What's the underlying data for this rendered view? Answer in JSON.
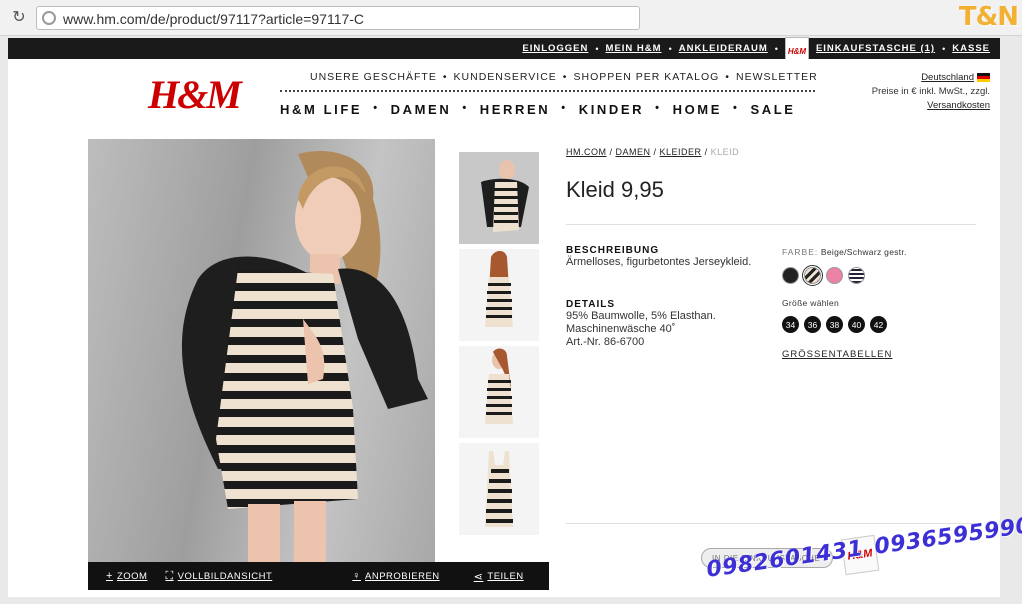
{
  "browser": {
    "url": "www.hm.com/de/product/97117?article=97117-C",
    "reload_icon": "reload-icon"
  },
  "watermark": {
    "logo": "T&N",
    "phones": [
      "0982601431",
      "0936595990"
    ]
  },
  "topbar": {
    "items": [
      "EINLOGGEN",
      "MEIN H&M",
      "ANKLEIDERAUM",
      "EINKAUFSTASCHE (1)",
      "KASSE"
    ]
  },
  "header": {
    "logo": "H&M",
    "subnav": [
      "UNSERE GESCHÄFTE",
      "KUNDENSERVICE",
      "SHOPPEN PER KATALOG",
      "NEWSLETTER"
    ],
    "mainnav": [
      "H&M LIFE",
      "DAMEN",
      "HERREN",
      "KINDER",
      "HOME",
      "SALE"
    ],
    "country": "Deutschland",
    "price_note": "Preise in € inkl. MwSt., zzgl.",
    "shipping": "Versandkosten"
  },
  "product": {
    "breadcrumb": [
      "HM.COM",
      "DAMEN",
      "KLEIDER",
      "KLEID"
    ],
    "title": "Kleid 9,95",
    "description_label": "BESCHREIBUNG",
    "description": "Ärmelloses, figurbetontes Jerseykleid.",
    "details_label": "DETAILS",
    "details": [
      "95% Baumwolle, 5% Elasthan.",
      "Maschinenwäsche 40˚",
      "Art.-Nr. 86-6700"
    ],
    "color_label": "FARBE:",
    "color_value": "Beige/Schwarz gestr.",
    "swatches": [
      "black",
      "beige-black-stripe",
      "pink",
      "navy-stripe"
    ],
    "size_label": "Größe wählen",
    "sizes": [
      "34",
      "36",
      "38",
      "40",
      "42"
    ],
    "size_table": "GRÖSSENTABELLEN",
    "add_to_bag": "IN DIE EINKAUFSTASCHE"
  },
  "toolbar": {
    "zoom": "ZOOM",
    "fullscreen": "VOLLBILDANSICHT",
    "try_on": "ANPROBIEREN",
    "share": "TEILEN"
  }
}
